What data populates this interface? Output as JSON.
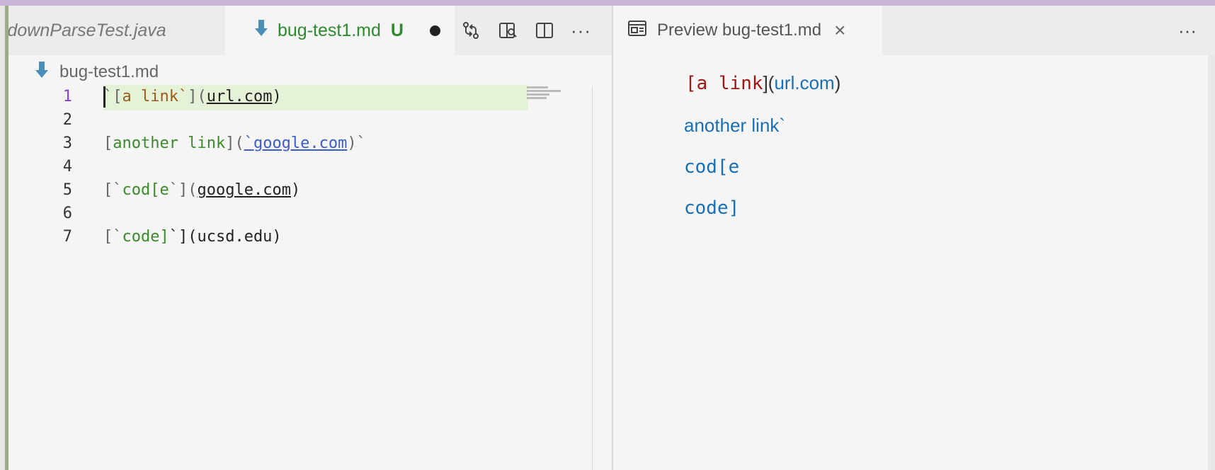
{
  "tabs": {
    "inactive": "kdownParseTest.java",
    "active": {
      "label": "bug-test1.md",
      "status": "U"
    },
    "toolbar_more": "···"
  },
  "breadcrumb": {
    "file": "bug-test1.md"
  },
  "editor": {
    "lines": [
      {
        "num": "1",
        "code": "`[a link`](url.com)"
      },
      {
        "num": "2",
        "code": ""
      },
      {
        "num": "3",
        "code": "[another link](`google.com)`"
      },
      {
        "num": "4",
        "code": ""
      },
      {
        "num": "5",
        "code": "[`cod[e`](google.com)"
      },
      {
        "num": "6",
        "code": ""
      },
      {
        "num": "7",
        "code": "[`code]`](ucsd.edu)"
      }
    ],
    "tokens": {
      "l1_tick": "`",
      "l1_bracket_open": "[",
      "l1_text": "a link`",
      "l1_bracket_close": "](",
      "l1_url": "url.com",
      "l1_paren": ")",
      "l3_bracket_open": "[",
      "l3_text": "another link",
      "l3_bracket_close": "](",
      "l3_url": "`google.com",
      "l3_tail": ")`",
      "l5_open": "[`",
      "l5_text": "cod[e",
      "l5_close": "`](",
      "l5_url": "google.com",
      "l5_paren": ")",
      "l7_open": "[`",
      "l7_text": "code]",
      "l7_close": "`](ucsd.edu)"
    }
  },
  "preview": {
    "tab_label": "Preview bug-test1.md",
    "more": "···",
    "lines": {
      "p1_open": "[a link",
      "p1_bracket": "](",
      "p1_url": "url.com",
      "p1_close": ")",
      "p2": "another link`",
      "p3": "cod[e",
      "p4": "code]"
    }
  },
  "colors": {
    "accent_purple": "#8b3fd1",
    "tab_green": "#2e8a2e",
    "link_blue": "#1a6fb3",
    "code_red": "#a31515"
  },
  "icons": [
    "markdown-icon",
    "compare-changes-icon",
    "open-preview-icon",
    "split-editor-icon",
    "more-actions-icon",
    "preview-icon",
    "close-icon"
  ]
}
